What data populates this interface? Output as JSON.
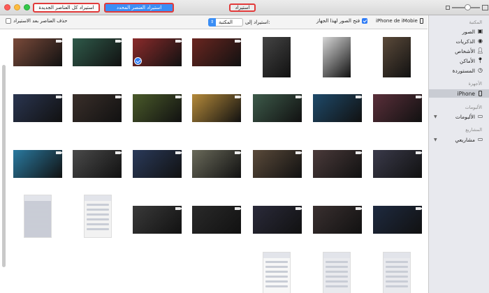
{
  "window": {
    "title": "استيراد",
    "import_new_label": "استيراد كل العناصر الجديدة",
    "import_selected_label": "استيراد العنصر المحدد",
    "zoom_level": 0.55
  },
  "toolbar": {
    "delete_after_import_label": "حذف العناصر بعد الاستيراد",
    "delete_after_import_checked": false,
    "import_to_label": "استيراد إلى:",
    "import_to_value": "المكتبة",
    "open_photos_label": "فتح الصور لهذا الجهاز",
    "open_photos_checked": true,
    "device_label": "iPhone de iMobie"
  },
  "sidebar": {
    "library_heading": "المكتبة",
    "library_items": [
      {
        "label": "الصور",
        "icon": "photos-icon"
      },
      {
        "label": "الذكريات",
        "icon": "memories-icon"
      },
      {
        "label": "الأشخاص",
        "icon": "people-icon"
      },
      {
        "label": "الأماكن",
        "icon": "places-icon"
      },
      {
        "label": "المستوردة",
        "icon": "imports-icon"
      }
    ],
    "devices_heading": "الأجهزة",
    "device_item": {
      "label": "iPhone",
      "icon": "iphone-icon"
    },
    "albums_heading": "الألبومات",
    "albums_item": {
      "label": "الألبومات",
      "icon": "folder-icon"
    },
    "projects_heading": "المشاريع",
    "projects_item": {
      "label": "مشاريعي",
      "icon": "folder-icon"
    }
  },
  "thumbnails": [
    {
      "type": "video",
      "color": "#7a4a3a"
    },
    {
      "type": "video",
      "color": "#2f5a4a"
    },
    {
      "type": "video",
      "color": "#8b2b2b",
      "selected": true
    },
    {
      "type": "video",
      "color": "#6a2620"
    },
    {
      "type": "photo",
      "color": "#444444"
    },
    {
      "type": "photo",
      "color": "#d6d6d6"
    },
    {
      "type": "photo",
      "color": "#5b4a3a"
    },
    {
      "type": "video",
      "color": "#2a3550"
    },
    {
      "type": "video",
      "color": "#3a2f2a"
    },
    {
      "type": "video",
      "color": "#4a5a2a"
    },
    {
      "type": "video",
      "color": "#b58a3a"
    },
    {
      "type": "video",
      "color": "#3d5a4a"
    },
    {
      "type": "video",
      "color": "#1e4a6a"
    },
    {
      "type": "video",
      "color": "#5a2f3a"
    },
    {
      "type": "video",
      "color": "#2a7aa0"
    },
    {
      "type": "video",
      "color": "#4a4a4a"
    },
    {
      "type": "video",
      "color": "#2a3a5a"
    },
    {
      "type": "video",
      "color": "#6a6a5a"
    },
    {
      "type": "video",
      "color": "#5a4a3a"
    },
    {
      "type": "video",
      "color": "#4a3a3a"
    },
    {
      "type": "video",
      "color": "#3a3a4a"
    },
    {
      "type": "video",
      "color": "#3a3a3a"
    },
    {
      "type": "video",
      "color": "#2a2a2a"
    },
    {
      "type": "screenshot",
      "color": "#c9ccd6"
    },
    {
      "type": "screenshot",
      "color": "#f2f2f2"
    },
    {
      "type": "video",
      "color": "#2a2a3a"
    },
    {
      "type": "video",
      "color": "#3a3030"
    },
    {
      "type": "video",
      "color": "#1e2a40"
    },
    {
      "type": "video",
      "color": "#2a2a2a"
    },
    {
      "type": "video",
      "color": "#3a3a3a"
    },
    {
      "type": "video",
      "color": "#4a4a4a"
    },
    {
      "type": "screenshot",
      "color": "#f7f7f7"
    },
    {
      "type": "screenshot",
      "color": "#e9eaee"
    },
    {
      "type": "screenshot",
      "color": "#e9eaee"
    }
  ],
  "colors": {
    "accent": "#3b8ef5",
    "highlight_border": "#e23a3a",
    "sidebar_bg": "#e8e9ee"
  }
}
